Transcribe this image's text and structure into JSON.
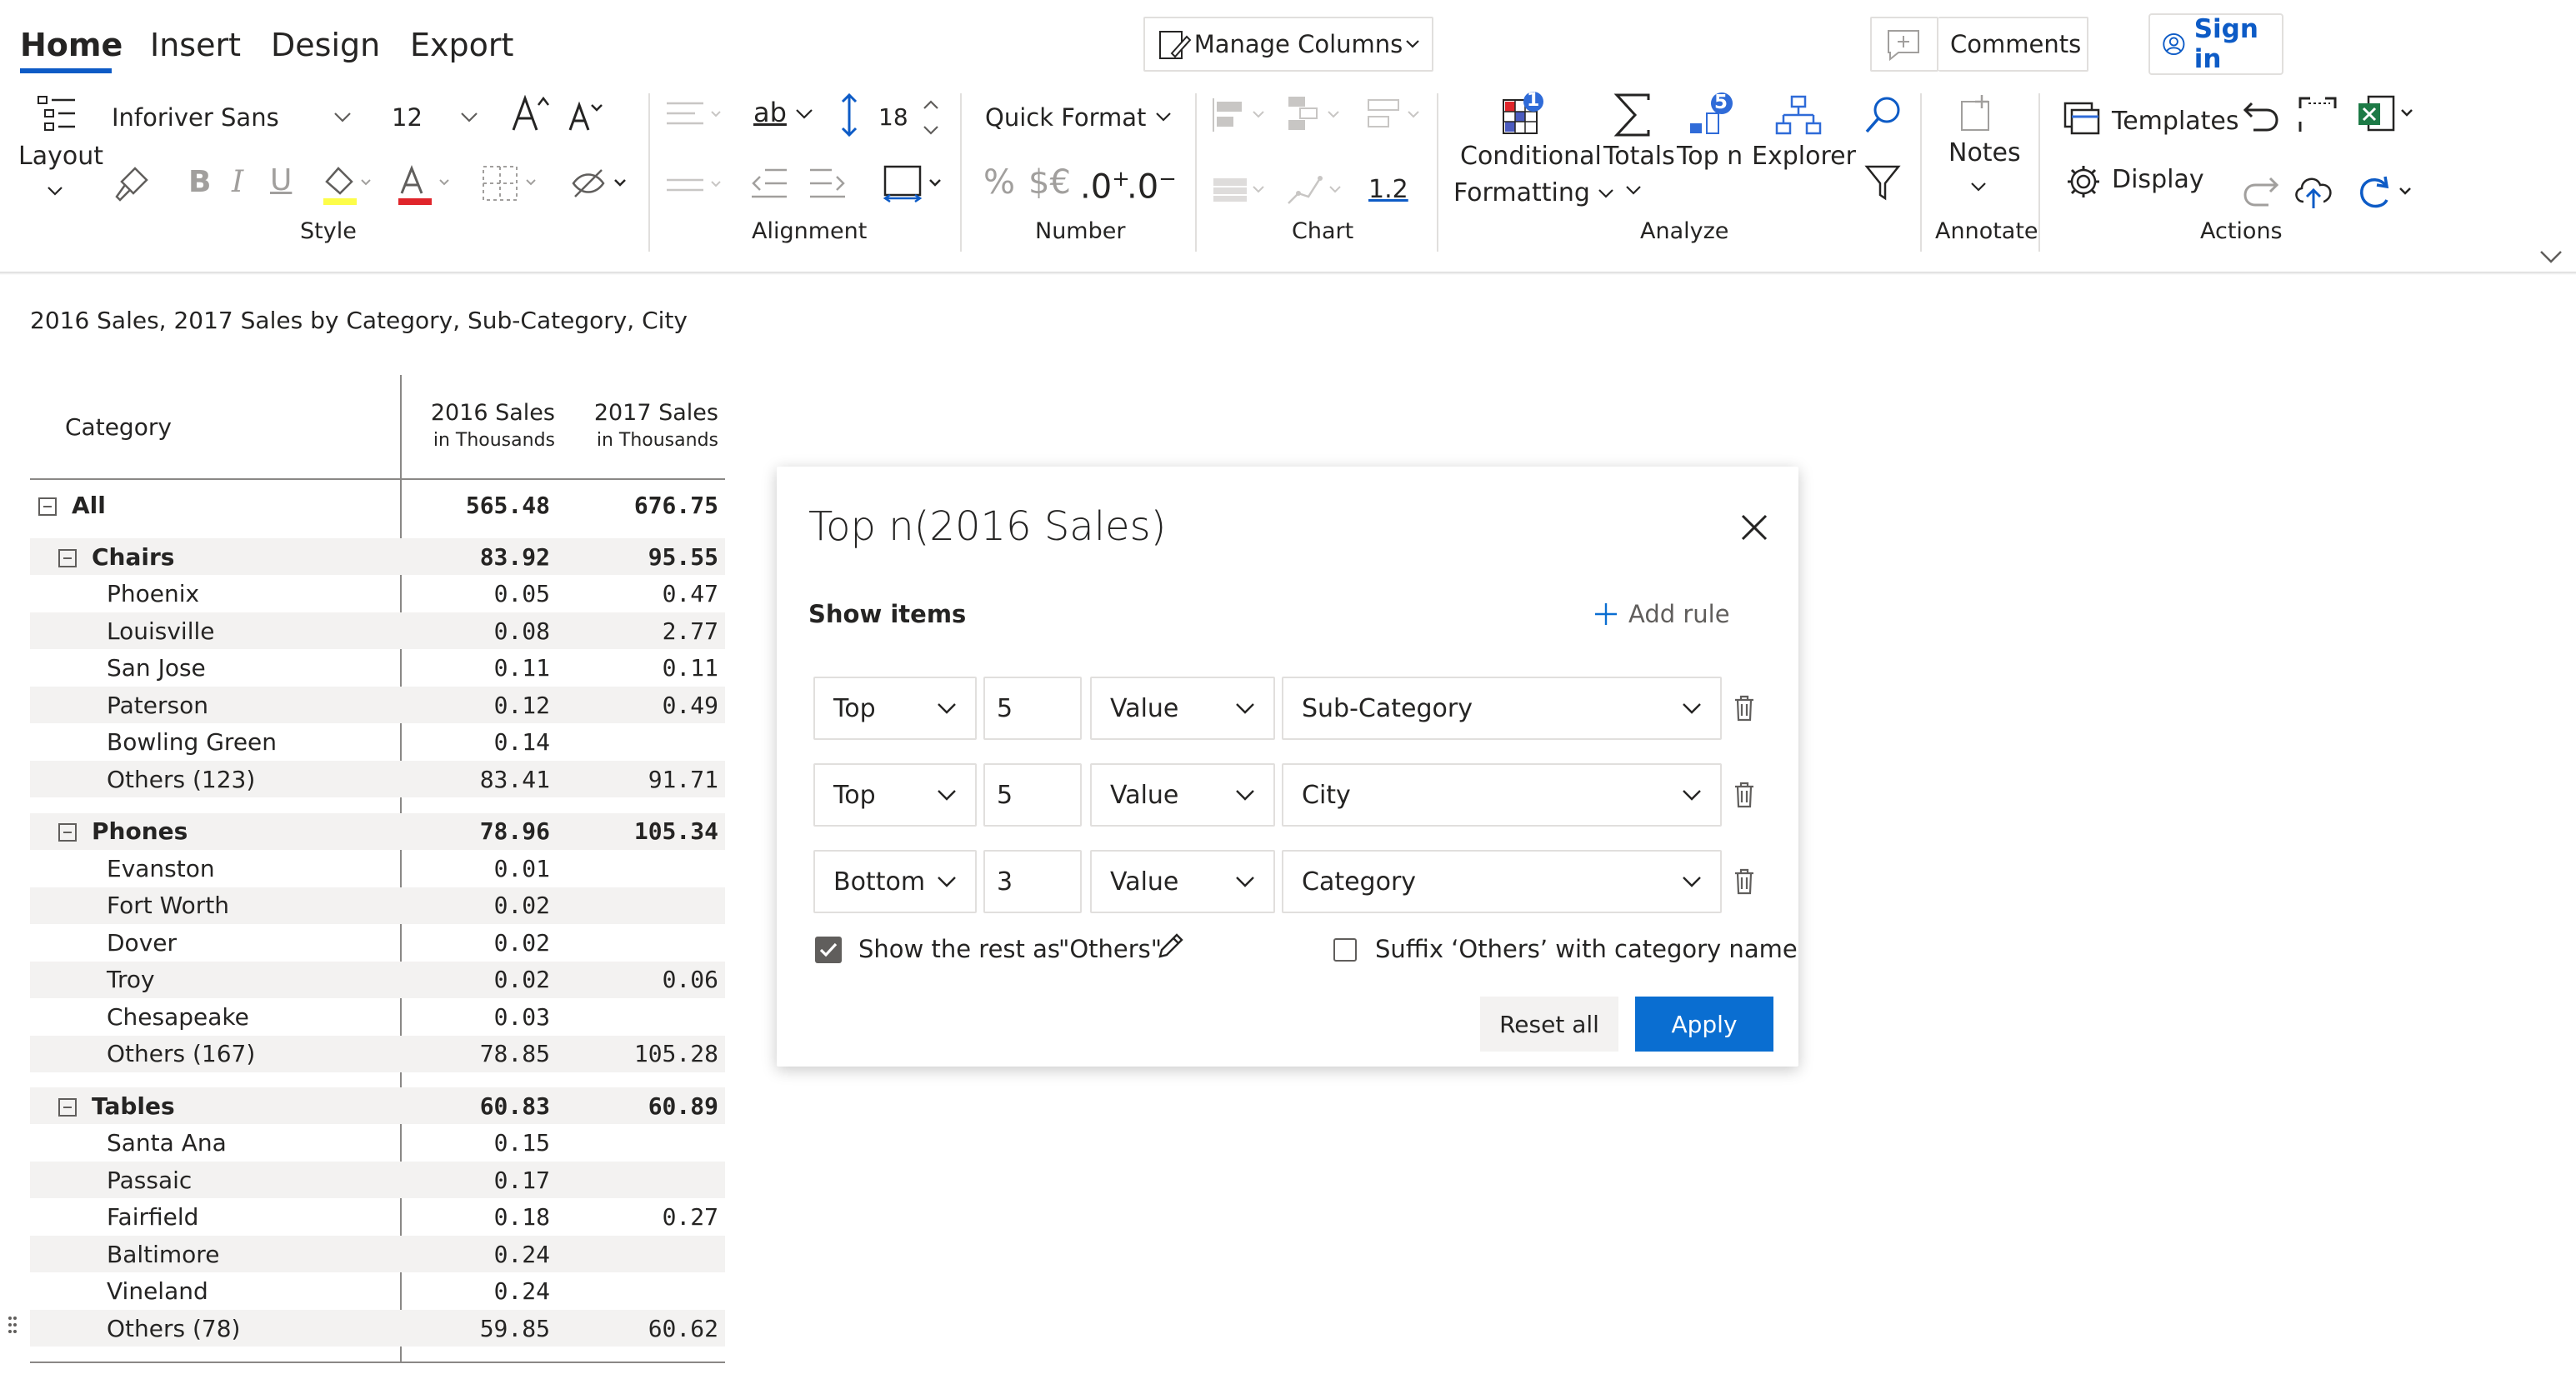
{
  "ribbon": {
    "tabs": [
      {
        "label": "Home",
        "active": true
      },
      {
        "label": "Insert"
      },
      {
        "label": "Design"
      },
      {
        "label": "Export"
      }
    ],
    "manage_columns": "Manage Columns",
    "comments": "Comments",
    "sign_in": "Sign in",
    "layout": "Layout",
    "font_family": "Inforiver Sans",
    "font_size": "12",
    "row_height": "18",
    "quick_format": "Quick Format",
    "percent": "%",
    "currency": "$€",
    "decimal_increase": ".0",
    "decimal_decrease": ".0",
    "chart_value": "1.2",
    "conditional": "Conditional",
    "formatting": "Formatting",
    "totals": "Totals",
    "topn": "Top n",
    "explorer": "Explorer",
    "notes": "Notes",
    "templates": "Templates",
    "display": "Display",
    "badge_conditional": "1",
    "badge_topn": "5",
    "groups": {
      "style": "Style",
      "alignment": "Alignment",
      "number": "Number",
      "chart": "Chart",
      "analyze": "Analyze",
      "annotate": "Annotate",
      "actions": "Actions"
    },
    "accent": "#0d5bc6"
  },
  "report": {
    "title": "2016 Sales, 2017 Sales by Category, Sub-Category, City",
    "header": {
      "category": "Category",
      "col1": "2016 Sales",
      "col1_sub": "in Thousands",
      "col2": "2017 Sales",
      "col2_sub": "in Thousands"
    },
    "rows": [
      {
        "name": "All",
        "v1": "565.48",
        "v2": "676.75",
        "level": 0,
        "bold": true
      },
      {
        "name": "Chairs",
        "v1": "83.92",
        "v2": "95.55",
        "level": 1,
        "bold": true
      },
      {
        "name": "Phoenix",
        "v1": "0.05",
        "v2": "0.47",
        "level": 2
      },
      {
        "name": "Louisville",
        "v1": "0.08",
        "v2": "2.77",
        "level": 2
      },
      {
        "name": "San Jose",
        "v1": "0.11",
        "v2": "0.11",
        "level": 2
      },
      {
        "name": "Paterson",
        "v1": "0.12",
        "v2": "0.49",
        "level": 2
      },
      {
        "name": "Bowling Green",
        "v1": "0.14",
        "v2": "",
        "level": 2
      },
      {
        "name": "Others (123)",
        "v1": "83.41",
        "v2": "91.71",
        "level": 2
      },
      {
        "name": "Phones",
        "v1": "78.96",
        "v2": "105.34",
        "level": 1,
        "bold": true
      },
      {
        "name": "Evanston",
        "v1": "0.01",
        "v2": "",
        "level": 2
      },
      {
        "name": "Fort Worth",
        "v1": "0.02",
        "v2": "",
        "level": 2
      },
      {
        "name": "Dover",
        "v1": "0.02",
        "v2": "",
        "level": 2
      },
      {
        "name": "Troy",
        "v1": "0.02",
        "v2": "0.06",
        "level": 2
      },
      {
        "name": "Chesapeake",
        "v1": "0.03",
        "v2": "",
        "level": 2
      },
      {
        "name": "Others (167)",
        "v1": "78.85",
        "v2": "105.28",
        "level": 2
      },
      {
        "name": "Tables",
        "v1": "60.83",
        "v2": "60.89",
        "level": 1,
        "bold": true
      },
      {
        "name": "Santa Ana",
        "v1": "0.15",
        "v2": "",
        "level": 2
      },
      {
        "name": "Passaic",
        "v1": "0.17",
        "v2": "",
        "level": 2
      },
      {
        "name": "Fairfield",
        "v1": "0.18",
        "v2": "0.27",
        "level": 2
      },
      {
        "name": "Baltimore",
        "v1": "0.24",
        "v2": "",
        "level": 2
      },
      {
        "name": "Vineland",
        "v1": "0.24",
        "v2": "",
        "level": 2
      },
      {
        "name": "Others (78)",
        "v1": "59.85",
        "v2": "60.62",
        "level": 2
      }
    ]
  },
  "dialog": {
    "title": "Top n(2016 Sales)",
    "show_items": "Show items",
    "add_rule": "Add rule",
    "rules": [
      {
        "direction": "Top",
        "count": "5",
        "basis": "Value",
        "field": "Sub-Category"
      },
      {
        "direction": "Top",
        "count": "5",
        "basis": "Value",
        "field": "City"
      },
      {
        "direction": "Bottom",
        "count": "3",
        "basis": "Value",
        "field": "Category"
      }
    ],
    "show_rest_label": "Show the rest as",
    "show_rest_value": "\"Others\"",
    "show_rest_checked": true,
    "suffix_label": "Suffix ‘Others’ with category name",
    "suffix_checked": false,
    "reset_all": "Reset all",
    "apply": "Apply",
    "apply_color": "#0a6ed1"
  }
}
